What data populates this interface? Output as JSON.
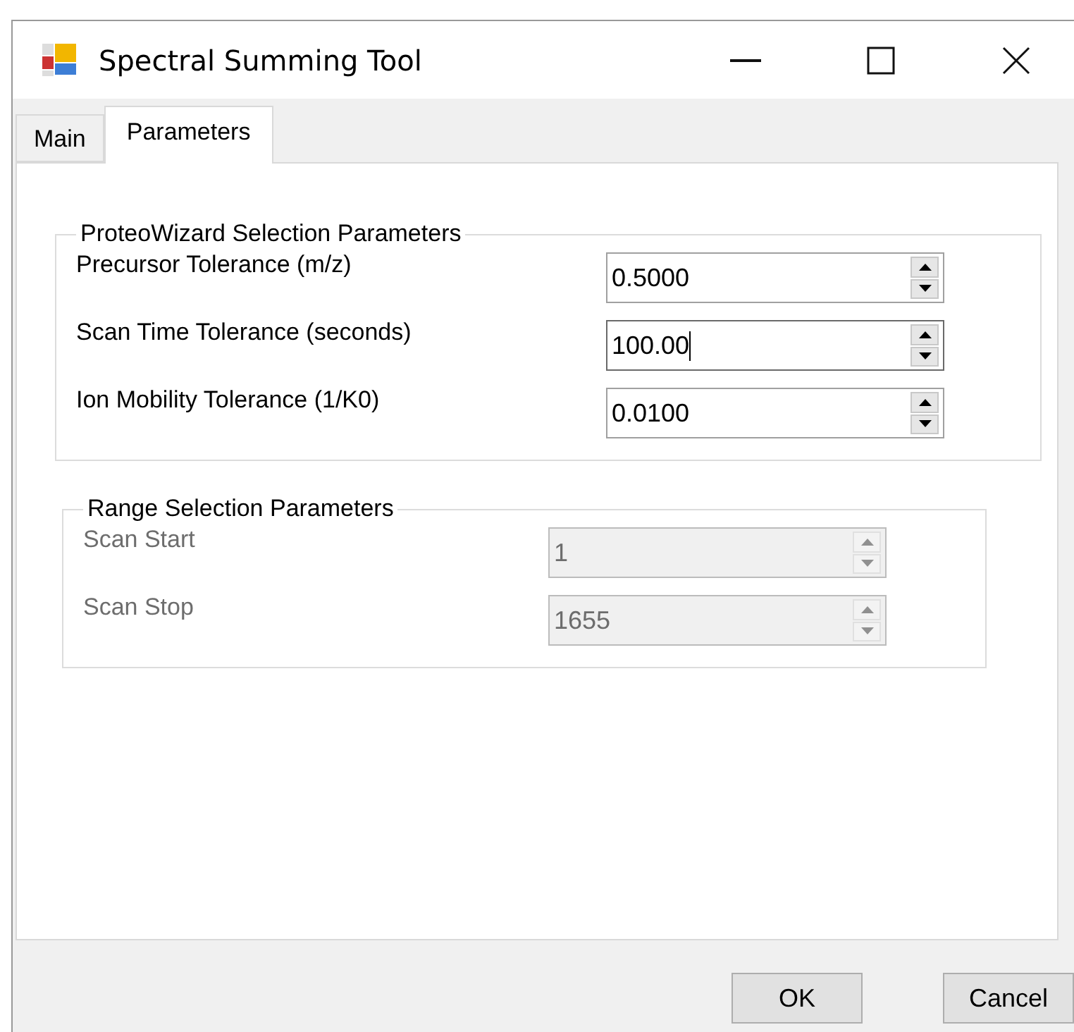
{
  "window": {
    "title": "Spectral Summing Tool"
  },
  "tabs": [
    {
      "label": "Main",
      "selected": false
    },
    {
      "label": "Parameters",
      "selected": true
    }
  ],
  "groups": [
    {
      "title": "ProteoWizard Selection Parameters",
      "disabled": false,
      "fields": [
        {
          "label": "Precursor Tolerance (m/z)",
          "value": "0.5000",
          "focused": false
        },
        {
          "label": "Scan Time Tolerance (seconds)",
          "value": "100.00",
          "focused": true
        },
        {
          "label": "Ion Mobility Tolerance (1/K0)",
          "value": "0.0100",
          "focused": false
        }
      ]
    },
    {
      "title": "Range Selection Parameters",
      "disabled": true,
      "fields": [
        {
          "label": "Scan Start",
          "value": "1",
          "focused": false
        },
        {
          "label": "Scan Stop",
          "value": "1655",
          "focused": false
        }
      ]
    }
  ],
  "buttons": [
    "OK",
    "Cancel"
  ]
}
